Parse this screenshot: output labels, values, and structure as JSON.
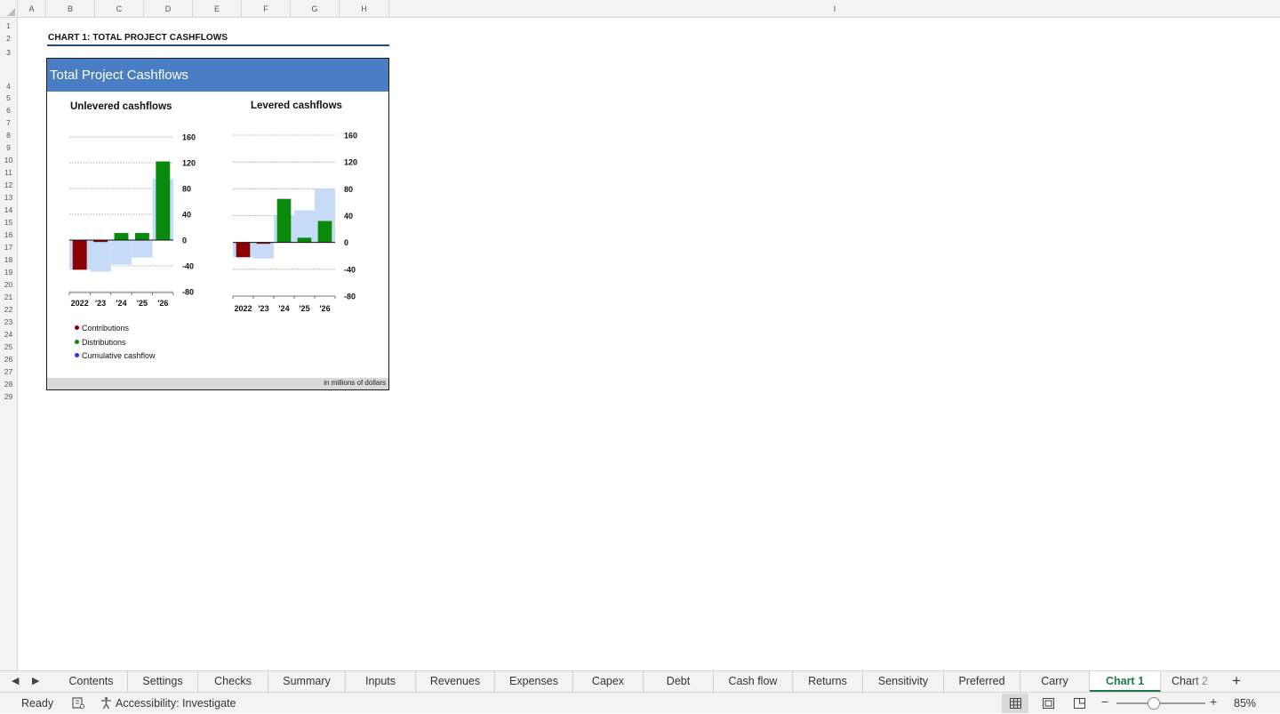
{
  "grid": {
    "columns": [
      "A",
      "B",
      "C",
      "D",
      "E",
      "F",
      "G",
      "H",
      "I"
    ],
    "rows": [
      "1",
      "2",
      "3",
      "4",
      "5",
      "6",
      "7",
      "8",
      "9",
      "10",
      "11",
      "12",
      "13",
      "14",
      "15",
      "16",
      "17",
      "18",
      "19",
      "20",
      "21",
      "22",
      "23",
      "24",
      "25",
      "26",
      "27",
      "28",
      "29"
    ]
  },
  "sheet": {
    "heading": "CHART 1: TOTAL PROJECT CASHFLOWS"
  },
  "chart": {
    "title": "Total Project Cashflows",
    "unit_note": "in millions of dollars",
    "legend": [
      {
        "label": "Contributions",
        "color": "#8b0000"
      },
      {
        "label": "Distributions",
        "color": "#0a8a0a"
      },
      {
        "label": "Cumulative cashflow",
        "color": "#3b2bf0"
      }
    ]
  },
  "chart_data": [
    {
      "type": "bar",
      "title": "Unlevered cashflows",
      "categories": [
        "2022",
        "'23",
        "'24",
        "'25",
        "'26"
      ],
      "ylim": [
        -80,
        160
      ],
      "yticks": [
        160,
        120,
        80,
        40,
        0,
        -40,
        -80
      ],
      "ytick_labels": [
        "160",
        "120",
        "80",
        "40",
        "0",
        "-40",
        "-80"
      ],
      "series": [
        {
          "name": "Contributions",
          "values": [
            -46,
            -3,
            0,
            0,
            0
          ],
          "color": "#8b0000"
        },
        {
          "name": "Distributions",
          "values": [
            0,
            0,
            11,
            11,
            122
          ],
          "color": "#0a8a0a"
        },
        {
          "name": "Cumulative cashflow",
          "values": [
            -46,
            -49,
            -38,
            -27,
            95
          ],
          "color": "#c6dbf7"
        }
      ]
    },
    {
      "type": "bar",
      "title": "Levered cashflows",
      "categories": [
        "2022",
        "'23",
        "'24",
        "'25",
        "'26"
      ],
      "ylim": [
        -80,
        160
      ],
      "yticks": [
        160,
        120,
        80,
        40,
        0,
        -40,
        -80
      ],
      "ytick_labels": [
        "160",
        "120",
        "80",
        "40",
        "0",
        "-40",
        "-80"
      ],
      "series": [
        {
          "name": "Contributions",
          "values": [
            -22,
            -2,
            0,
            0,
            0
          ],
          "color": "#8b0000"
        },
        {
          "name": "Distributions",
          "values": [
            0,
            0,
            65,
            7,
            32
          ],
          "color": "#0a8a0a"
        },
        {
          "name": "Cumulative cashflow",
          "values": [
            -22,
            -24,
            41,
            48,
            80
          ],
          "color": "#c6dbf7"
        }
      ]
    }
  ],
  "tabs": {
    "items": [
      "Contents",
      "Settings",
      "Checks",
      "Summary",
      "Inputs",
      "Revenues",
      "Expenses",
      "Capex",
      "Debt",
      "Cash flow",
      "Returns",
      "Sensitivity",
      "Preferred",
      "Carry",
      "Chart 1",
      "Chart 2"
    ],
    "active": "Chart 1",
    "add_label": "+"
  },
  "status": {
    "ready": "Ready",
    "accessibility": "Accessibility: Investigate",
    "zoom": "85%",
    "zoom_minus": "−",
    "zoom_plus": "+"
  }
}
